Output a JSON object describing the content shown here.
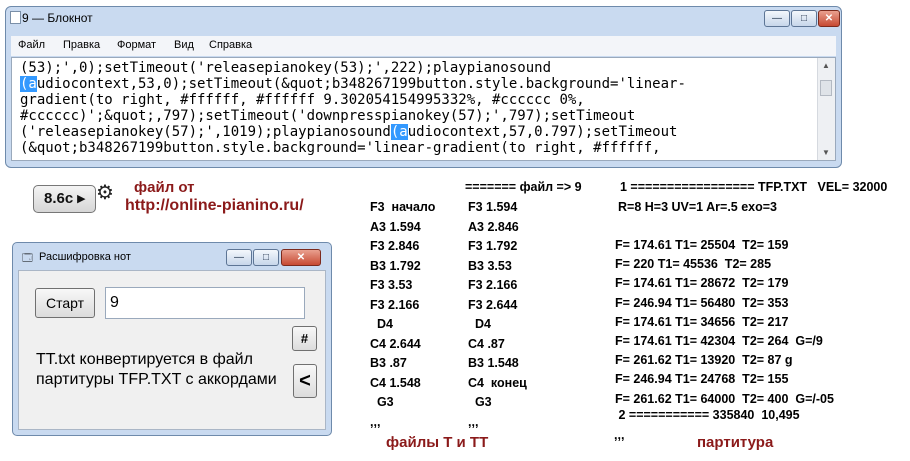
{
  "notepad": {
    "title": "9 — Блокнот",
    "menu": [
      "Файл",
      "Правка",
      "Формат",
      "Вид",
      "Справка"
    ],
    "minimize": "—",
    "maximize": "□",
    "close": "✕",
    "lines": [
      {
        "before": "(53);',0);setTimeout('releasepianokey(53);',222);playpianosound",
        "sel": "",
        "after": ""
      },
      {
        "before": "",
        "sel": "(a",
        "after": "udiocontext,53,0);setTimeout(&quot;b348267199button.style.background='linear-"
      },
      {
        "before": "gradient(to right, #ffffff, #ffffff 9.302054154995332%, #cccccc 0%,",
        "sel": "",
        "after": ""
      },
      {
        "before": "#cccccc)';&quot;,797);setTimeout('downpresspianokey(57);',797);setTimeout",
        "sel": "",
        "after": ""
      },
      {
        "before": "('releasepianokey(57);',1019);playpianosound",
        "sel": "(a",
        "after": "udiocontext,57,0.797);setTimeout"
      },
      {
        "before": "(&quot;b348267199button.style.background='linear-gradient(to right, #ffffff,",
        "sel": "",
        "after": ""
      }
    ]
  },
  "toolbar": {
    "button_label": "8.6c ▸",
    "gear_icon": "⚙",
    "source_line1": "файл от",
    "source_line2": "http://online-pianino.ru/"
  },
  "dialog": {
    "title": "Расшифровка нот",
    "start_label": "Старт",
    "input_value": "9",
    "hash_label": "#",
    "back_label": "<",
    "message": "TT.txt конвертируется в файл партитуры TFP.TXT с аккордами",
    "minimize": "—",
    "maximize": "□",
    "close": "✕"
  },
  "t_file": {
    "rows": [
      "F3  начало",
      "A3 1.594",
      "F3 2.846",
      "B3 1.792",
      "F3 3.53",
      "F3 2.166",
      "  D4",
      "C4 2.644",
      "B3 .87",
      "C4 1.548",
      "  G3",
      ",,,"
    ]
  },
  "tt_file": {
    "header": "======= файл => 9",
    "rows": [
      "F3 1.594",
      "A3 2.846",
      "F3 1.792",
      "B3 3.53",
      "F3 2.166",
      "F3 2.644",
      "  D4",
      "C4 .87",
      "B3 1.548",
      "C4  конец",
      "  G3",
      ",,,"
    ]
  },
  "files_caption": "файлы T и TT",
  "score": {
    "header": "1 ================= TFP.TXT   VEL= 32000",
    "params": "R=8 H=3 UV=1 Ar=.5 exo=3",
    "rows": [
      "F= 174.61 T1= 25504  T2= 159",
      "F= 220 T1= 45536  T2= 285",
      "F= 174.61 T1= 28672  T2= 179",
      "F= 246.94 T1= 56480  T2= 353",
      "F= 174.61 T1= 34656  T2= 217",
      "F= 174.61 T1= 42304  T2= 264  G=/9",
      "F= 261.62 T1= 13920  T2= 87 g",
      "F= 246.94 T1= 24768  T2= 155",
      "F= 261.62 T1= 64000  T2= 400  G=/-05"
    ],
    "footer": " 2 =========== 335840  10,495",
    "end_mark": ",,,",
    "caption": "партитура"
  }
}
